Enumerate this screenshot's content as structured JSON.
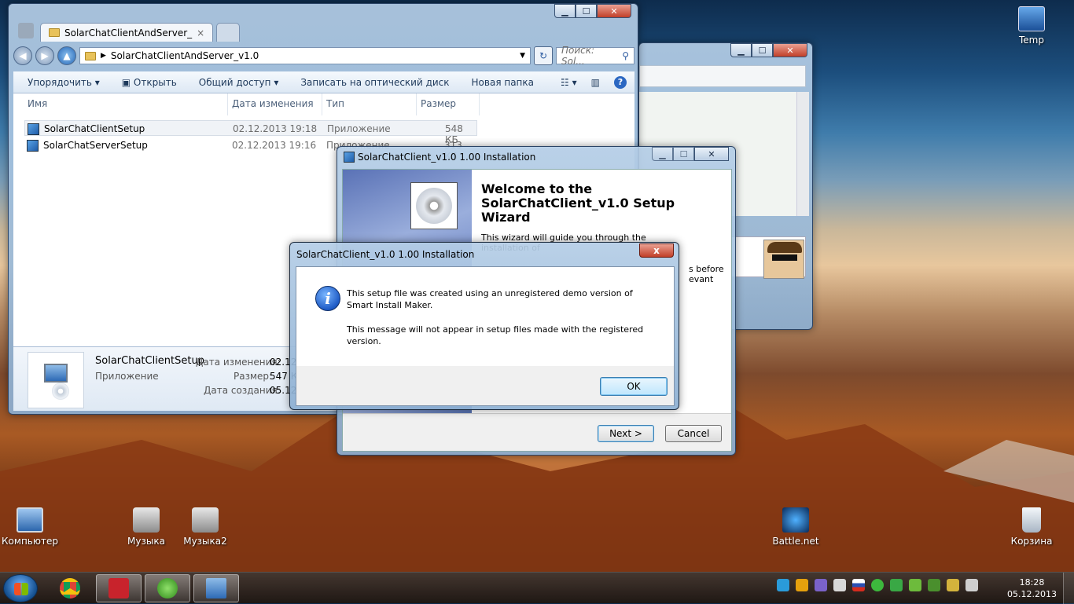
{
  "explorer": {
    "tab_active": "SolarChatClientAndServer_",
    "address": "SolarChatClientAndServer_v1.0",
    "search_placeholder": "Поиск: Sol...",
    "toolbar": {
      "organize": "Упорядочить ▾",
      "open": "Открыть",
      "share": "Общий доступ ▾",
      "burn": "Записать на оптический диск",
      "new_folder": "Новая папка"
    },
    "columns": {
      "name": "Имя",
      "date": "Дата изменения",
      "type": "Тип",
      "size": "Размер"
    },
    "files": [
      {
        "name": "SolarChatClientSetup",
        "date": "02.12.2013 19:18",
        "type": "Приложение",
        "size": "548 КБ"
      },
      {
        "name": "SolarChatServerSetup",
        "date": "02.12.2013 19:16",
        "type": "Приложение",
        "size": "313 КБ"
      }
    ],
    "details": {
      "name": "SolarChatClientSetup",
      "kind": "Приложение",
      "modified_label": "Дата изменения:",
      "modified_value": "02.12",
      "size_label": "Размер:",
      "size_value": "547 К",
      "created_label": "Дата создания:",
      "created_value": "05.12"
    }
  },
  "wizard": {
    "title": "SolarChatClient_v1.0 1.00 Installation",
    "heading": "Welcome to the SolarChatClient_v1.0 Setup Wizard",
    "body": "This wizard will guide you through the installation of",
    "body_right": "s before evant",
    "next": "Next >",
    "cancel": "Cancel"
  },
  "msgbox": {
    "title": "SolarChatClient_v1.0 1.00 Installation",
    "line1": "This setup file was created using an unregistered demo version of Smart Install Maker.",
    "line2": "This message will not appear in setup files made with the registered version.",
    "ok": "OK",
    "close": "x"
  },
  "desktop": {
    "icons": {
      "computer": "Компьютер",
      "music": "Музыка",
      "music2": "Музыка2",
      "battlenet": "Battle.net",
      "recycle": "Корзина",
      "temp": "Temp"
    }
  },
  "taskbar": {
    "time": "18:28",
    "date": "05.12.2013"
  }
}
